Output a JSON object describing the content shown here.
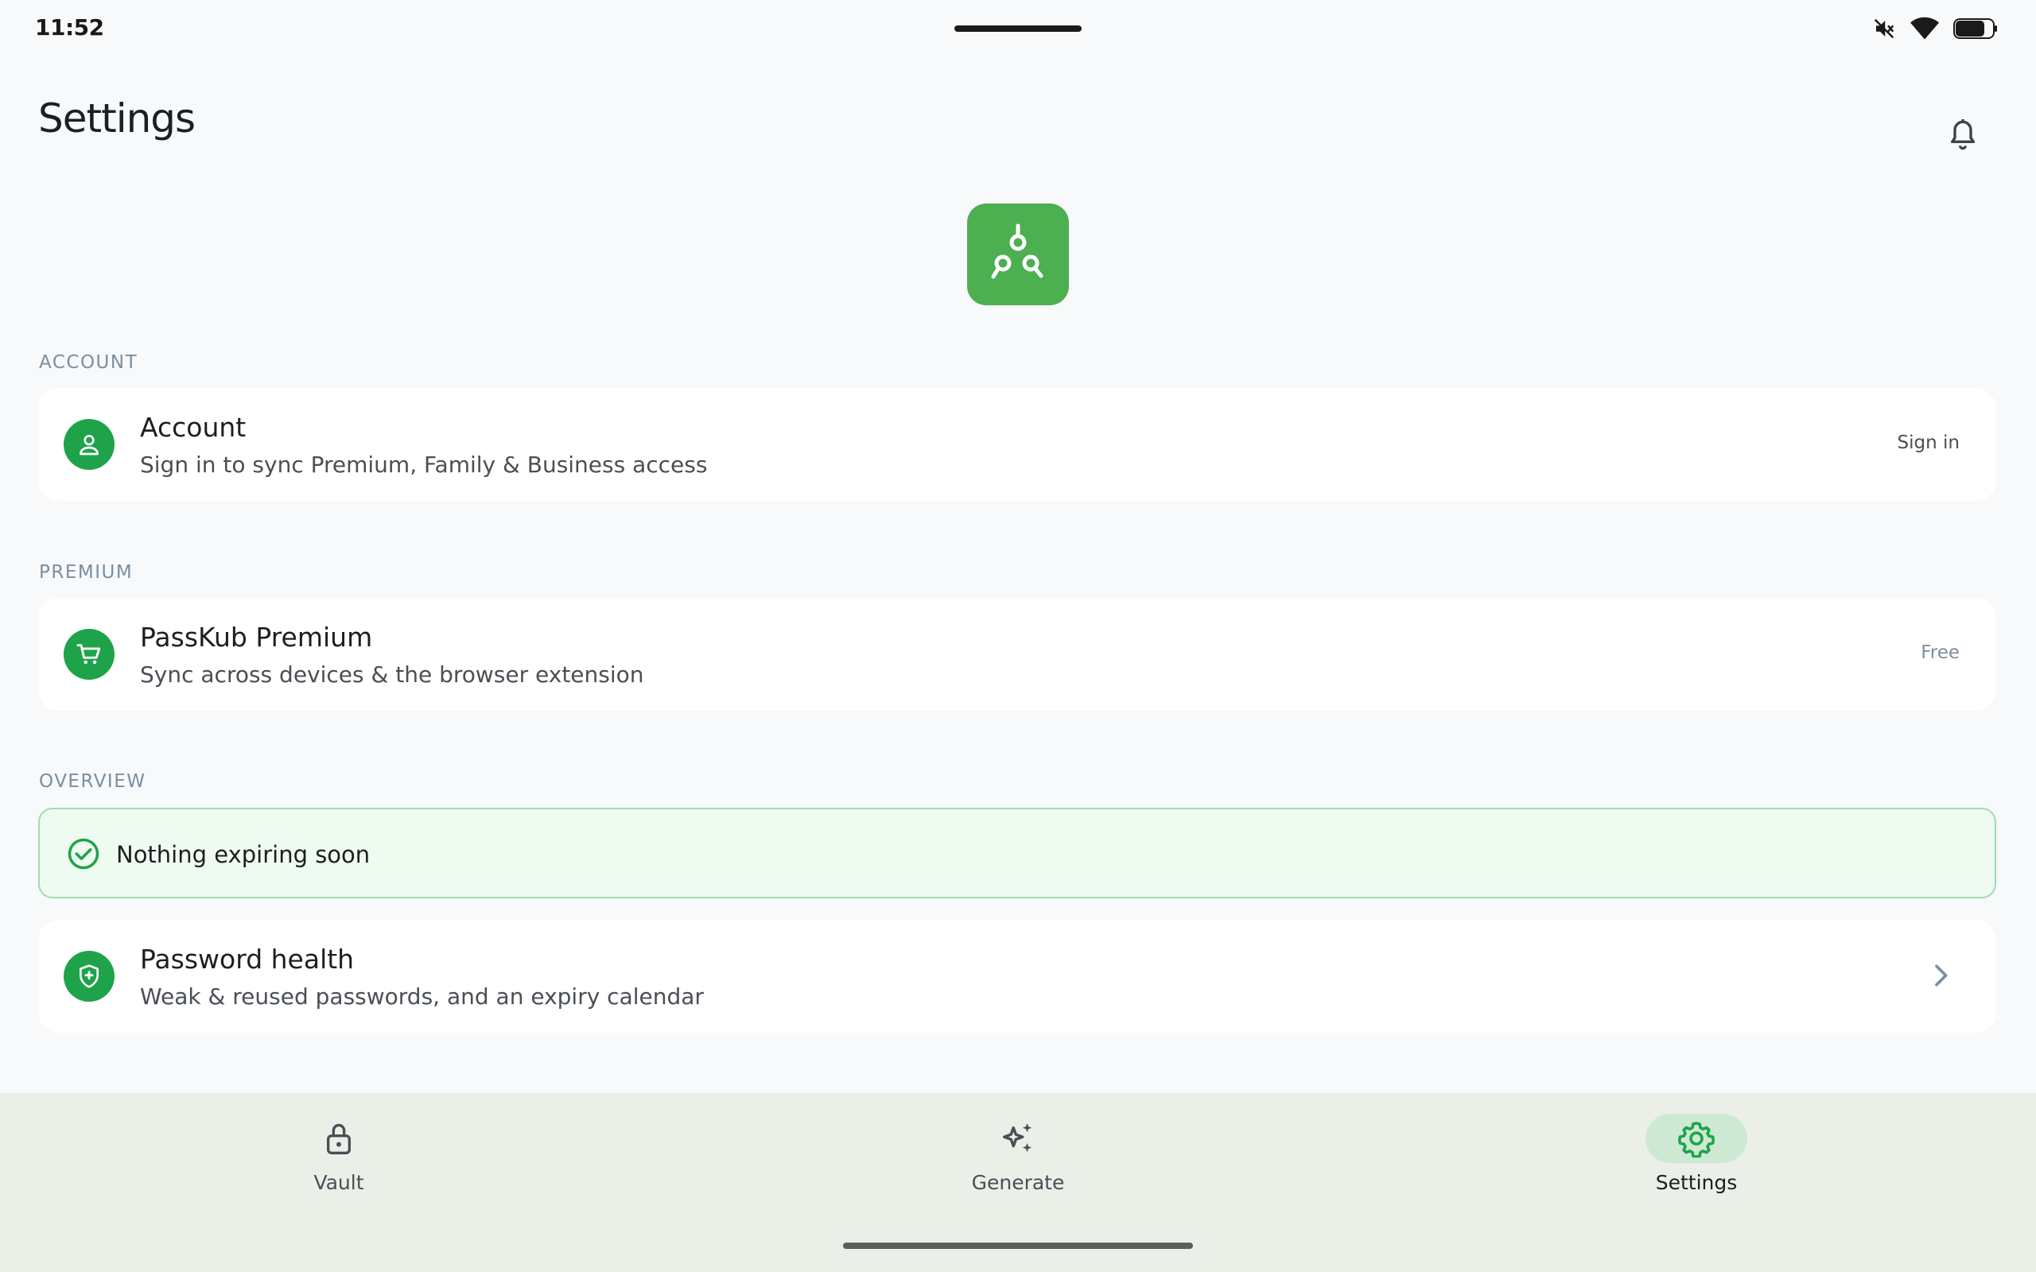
{
  "status_bar": {
    "time": "11:52",
    "icons": [
      "mute-icon",
      "wifi-icon",
      "battery-icon"
    ]
  },
  "header": {
    "title": "Settings",
    "notifications_icon": "bell-icon"
  },
  "logo": {
    "icon": "passkub-logo",
    "color": "#4caf50"
  },
  "sections": {
    "account": {
      "label": "ACCOUNT",
      "title": "Account",
      "subtitle": "Sign in to sync Premium, Family & Business access",
      "action": "Sign in",
      "icon": "person-icon"
    },
    "premium": {
      "label": "PREMIUM",
      "title": "PassKub Premium",
      "subtitle": "Sync across devices & the browser extension",
      "status": "Free",
      "icon": "cart-icon"
    },
    "overview": {
      "label": "OVERVIEW",
      "notice": "Nothing expiring soon",
      "notice_icon": "check-circle-icon",
      "health_title": "Password health",
      "health_subtitle": "Weak & reused passwords, and an expiry calendar",
      "health_icon": "shield-icon"
    }
  },
  "bottom_nav": {
    "items": [
      {
        "label": "Vault",
        "icon": "lock-icon",
        "active": false
      },
      {
        "label": "Generate",
        "icon": "sparkle-icon",
        "active": false
      },
      {
        "label": "Settings",
        "icon": "gear-icon",
        "active": true
      }
    ]
  },
  "colors": {
    "accent": "#1ea34a",
    "background": "#f7f9fb",
    "notice_bg": "#eefbf1",
    "nav_bg": "#ecefe8"
  }
}
